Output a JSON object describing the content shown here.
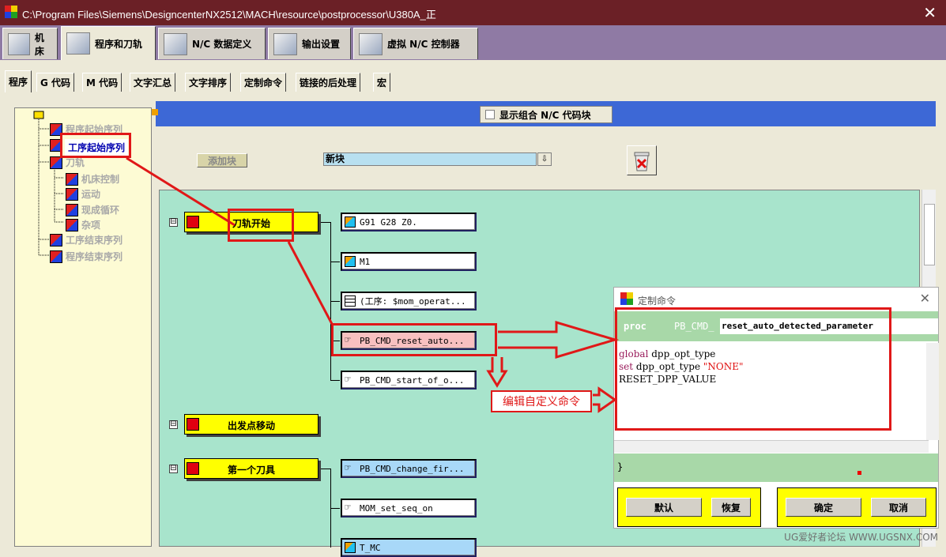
{
  "window": {
    "title": "C:\\Program Files\\Siemens\\DesigncenterNX2512\\MACH\\resource\\postprocessor\\U380A_正",
    "close_glyph": "✕"
  },
  "main_tabs": [
    {
      "label": "机床",
      "icon": "machine-icon"
    },
    {
      "label": "程序和刀轨",
      "icon": "program-toolpath-icon"
    },
    {
      "label": "N/C 数据定义",
      "icon": "nc-data-icon"
    },
    {
      "label": "输出设置",
      "icon": "printer-icon"
    },
    {
      "label": "虚拟 N/C 控制器",
      "icon": "virtual-controller-icon"
    }
  ],
  "sub_tabs": [
    "程序",
    "G 代码",
    "M 代码",
    "文字汇总",
    "文字排序",
    "定制命令",
    "链接的后处理",
    "宏"
  ],
  "tree": {
    "items": [
      "程序起始序列",
      "工序起始序列",
      "刀轨",
      "机床控制",
      "运动",
      "现成循环",
      "杂项",
      "工序结束序列",
      "程序结束序列"
    ]
  },
  "toolbar": {
    "show_combined_label": "显示组合 N/C 代码块",
    "add_block_label": "添加块",
    "new_block_value": "新块",
    "dropdown_arrow": "⇩"
  },
  "canvas": {
    "expander_glyph": "⊟",
    "blocks": [
      {
        "label": "刀轨开始",
        "commands": [
          "G91 G28 Z0.",
          "M1",
          "(工序: $mom_operat...",
          "PB_CMD_reset_auto...",
          "PB_CMD_start_of_o..."
        ]
      },
      {
        "label": "出发点移动",
        "commands": []
      },
      {
        "label": "第一个刀具",
        "commands": [
          "PB_CMD_change_fir...",
          "MOM_set_seq_on",
          "T_MC"
        ]
      }
    ]
  },
  "dialog": {
    "title": "定制命令",
    "close_glyph": "✕",
    "proc_keyword": "proc",
    "proc_prefix": "PB_CMD_",
    "proc_name": "reset_auto_detected_parameter",
    "code_lines": [
      {
        "kw": "global",
        "rest": " dpp_opt_type",
        "str": ""
      },
      {
        "kw": "set",
        "rest": " dpp_opt_type ",
        "str": "\"NONE\""
      },
      {
        "kw": "",
        "rest": "RESET_DPP_VALUE",
        "str": ""
      }
    ],
    "closing_brace": "}",
    "buttons": {
      "default": "默认",
      "restore": "恢复",
      "ok": "确定",
      "cancel": "取消"
    }
  },
  "annotation": {
    "label": "编辑自定义命令",
    "color": "#e01818"
  },
  "watermark": "UG爱好者论坛 WWW.UGSNX.COM"
}
